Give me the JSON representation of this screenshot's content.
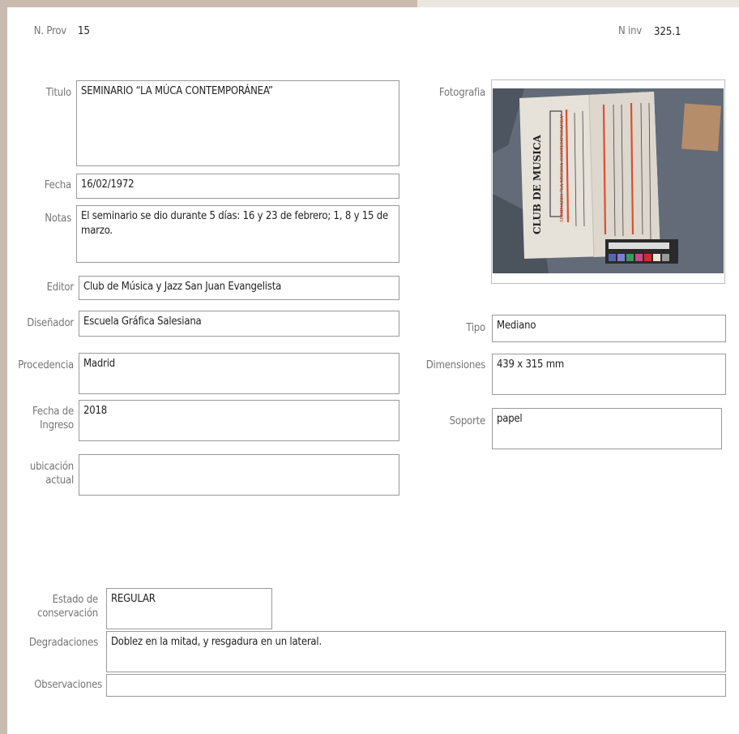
{
  "header": {
    "nprov_label": "N. Prov",
    "nprov_value": "15",
    "ninv_label": "N inv",
    "ninv_value": "325.1"
  },
  "left_fields": {
    "titulo": {
      "label": "Titulo",
      "value": "SEMINARIO “LA MÚCA CONTEMPORÁNEA”"
    },
    "fecha": {
      "label": "Fecha",
      "value": "16/02/1972"
    },
    "notas": {
      "label": "Notas",
      "value": "El seminario se dio durante 5 días: 16 y 23 de febrero; 1, 8 y 15 de marzo."
    },
    "editor": {
      "label": "Editor",
      "value": "Club de Música y Jazz San Juan Evangelista"
    },
    "disenador": {
      "label": "Diseñador",
      "value": "Escuela Gráfica Salesiana"
    },
    "procedencia": {
      "label": "Procedencia",
      "value": "Madrid"
    },
    "fecha_ingreso": {
      "label_line1": "Fecha de",
      "label_line2": "Ingreso",
      "value": "2018"
    },
    "ubicacion": {
      "label_line1": "ubicación",
      "label_line2": "actual",
      "value": ""
    }
  },
  "right_fields": {
    "fotografia": {
      "label": "Fotografia"
    },
    "tipo": {
      "label": "Tipo",
      "value": "Mediano"
    },
    "dimensiones": {
      "label": "Dimensiones",
      "value": "439 x 315 mm"
    },
    "soporte": {
      "label": "Soporte",
      "value": "papel"
    }
  },
  "photo": {
    "poster_title": "CLUB DE MUSICA",
    "poster_subtitle": "SEMINARIO “LA MUSICA CONTEMPORANEA”",
    "colors": {
      "background": "#5b6470",
      "paper": "#e6e1d9",
      "accent_red": "#d9502e",
      "card": "#b58d6a"
    }
  },
  "conservation": {
    "estado": {
      "label_line1": "Estado de",
      "label_line2": "conservación",
      "value": "REGULAR"
    },
    "degradaciones": {
      "label": "Degradaciones",
      "value": "Doblez en la mitad, y resgadura en un lateral."
    },
    "observaciones": {
      "label": "Observaciones",
      "value": ""
    }
  }
}
